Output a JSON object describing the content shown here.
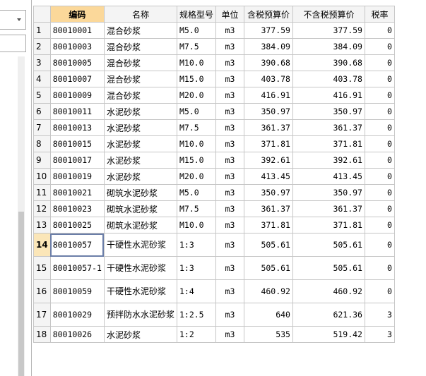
{
  "columns": [
    "",
    "编码",
    "名称",
    "规格型号",
    "单位",
    "含税预算价",
    "不含税预算价",
    "税率"
  ],
  "rows": [
    {
      "n": "1",
      "code": "80010001",
      "name": "混合砂浆",
      "spec": "M5.0",
      "unit": "m3",
      "tax_price": "377.59",
      "notax_price": "377.59",
      "rate": "0"
    },
    {
      "n": "2",
      "code": "80010003",
      "name": "混合砂浆",
      "spec": "M7.5",
      "unit": "m3",
      "tax_price": "384.09",
      "notax_price": "384.09",
      "rate": "0"
    },
    {
      "n": "3",
      "code": "80010005",
      "name": "混合砂浆",
      "spec": "M10.0",
      "unit": "m3",
      "tax_price": "390.68",
      "notax_price": "390.68",
      "rate": "0"
    },
    {
      "n": "4",
      "code": "80010007",
      "name": "混合砂浆",
      "spec": "M15.0",
      "unit": "m3",
      "tax_price": "403.78",
      "notax_price": "403.78",
      "rate": "0"
    },
    {
      "n": "5",
      "code": "80010009",
      "name": "混合砂浆",
      "spec": "M20.0",
      "unit": "m3",
      "tax_price": "416.91",
      "notax_price": "416.91",
      "rate": "0"
    },
    {
      "n": "6",
      "code": "80010011",
      "name": "水泥砂浆",
      "spec": "M5.0",
      "unit": "m3",
      "tax_price": "350.97",
      "notax_price": "350.97",
      "rate": "0"
    },
    {
      "n": "7",
      "code": "80010013",
      "name": "水泥砂浆",
      "spec": "M7.5",
      "unit": "m3",
      "tax_price": "361.37",
      "notax_price": "361.37",
      "rate": "0"
    },
    {
      "n": "8",
      "code": "80010015",
      "name": "水泥砂浆",
      "spec": "M10.0",
      "unit": "m3",
      "tax_price": "371.81",
      "notax_price": "371.81",
      "rate": "0"
    },
    {
      "n": "9",
      "code": "80010017",
      "name": "水泥砂浆",
      "spec": "M15.0",
      "unit": "m3",
      "tax_price": "392.61",
      "notax_price": "392.61",
      "rate": "0"
    },
    {
      "n": "10",
      "code": "80010019",
      "name": "水泥砂浆",
      "spec": "M20.0",
      "unit": "m3",
      "tax_price": "413.45",
      "notax_price": "413.45",
      "rate": "0"
    },
    {
      "n": "11",
      "code": "80010021",
      "name": "砌筑水泥砂浆",
      "spec": "M5.0",
      "unit": "m3",
      "tax_price": "350.97",
      "notax_price": "350.97",
      "rate": "0"
    },
    {
      "n": "12",
      "code": "80010023",
      "name": "砌筑水泥砂浆",
      "spec": "M7.5",
      "unit": "m3",
      "tax_price": "361.37",
      "notax_price": "361.37",
      "rate": "0"
    },
    {
      "n": "13",
      "code": "80010025",
      "name": "砌筑水泥砂浆",
      "spec": "M10.0",
      "unit": "m3",
      "tax_price": "371.81",
      "notax_price": "371.81",
      "rate": "0"
    },
    {
      "n": "14",
      "code": "80010057",
      "name": "干硬性水泥砂浆",
      "spec": "1:3",
      "unit": "m3",
      "tax_price": "505.61",
      "notax_price": "505.61",
      "rate": "0"
    },
    {
      "n": "15",
      "code": "80010057-1",
      "name": "干硬性水泥砂浆",
      "spec": "1:3",
      "unit": "m3",
      "tax_price": "505.61",
      "notax_price": "505.61",
      "rate": "0"
    },
    {
      "n": "16",
      "code": "80010059",
      "name": "干硬性水泥砂浆",
      "spec": "1:4",
      "unit": "m3",
      "tax_price": "460.92",
      "notax_price": "460.92",
      "rate": "0"
    },
    {
      "n": "17",
      "code": "80010029",
      "name": "预拌防水水泥砂浆",
      "spec": "1:2.5",
      "unit": "m3",
      "tax_price": "640",
      "notax_price": "621.36",
      "rate": "3"
    },
    {
      "n": "18",
      "code": "80010026",
      "name": "水泥砂浆",
      "spec": "1:2",
      "unit": "m3",
      "tax_price": "535",
      "notax_price": "519.42",
      "rate": "3"
    }
  ],
  "active_row": "14",
  "sorted_column": "编码",
  "colors": {
    "header_bg": "#f4f4f4",
    "sorted_header_bg": "#fbd89a",
    "grid_line": "#c6c6c6"
  }
}
